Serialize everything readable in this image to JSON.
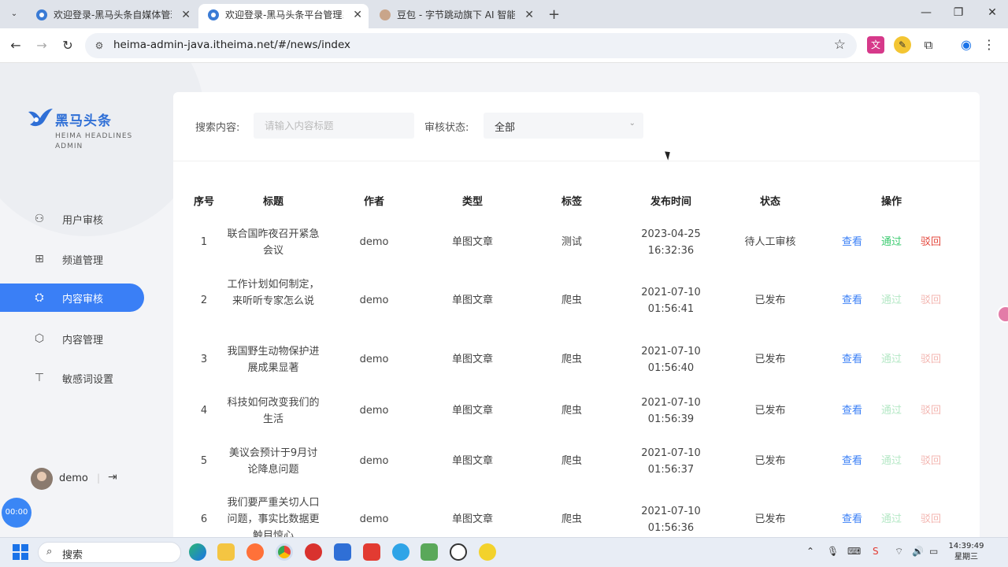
{
  "browser": {
    "tabs": [
      {
        "title": "欢迎登录-黑马头条自媒体管理",
        "active": false
      },
      {
        "title": "欢迎登录-黑马头条平台管理系",
        "active": true
      },
      {
        "title": "豆包 - 字节跳动旗下 AI 智能助",
        "active": false
      }
    ],
    "new_tab": "+",
    "url_domain": "heima-admin-java.itheima.net",
    "url_path": "/#/news/index"
  },
  "brand": {
    "name_cn": "黑马头条",
    "name_en_line1": "HEIMA HEADLINES",
    "name_en_line2": "ADMIN",
    "primary_color": "#3a7ff6"
  },
  "sidebar": {
    "items": [
      {
        "label": "用户审核",
        "icon": "user-check-icon",
        "active": false
      },
      {
        "label": "频道管理",
        "icon": "grid-icon",
        "active": false
      },
      {
        "label": "内容审核",
        "icon": "content-audit-icon",
        "active": true
      },
      {
        "label": "内容管理",
        "icon": "cube-icon",
        "active": false
      },
      {
        "label": "敏感词设置",
        "icon": "text-box-icon",
        "active": false
      }
    ],
    "user": {
      "name": "demo",
      "separator": "|"
    },
    "timer": "00:00"
  },
  "filters": {
    "search_label": "搜索内容:",
    "search_placeholder": "请输入内容标题",
    "status_label": "审核状态:",
    "status_value": "全部"
  },
  "table": {
    "columns": [
      "序号",
      "标题",
      "作者",
      "类型",
      "标签",
      "发布时间",
      "状态",
      "操作"
    ],
    "actions": {
      "view": "查看",
      "pass": "通过",
      "reject": "驳回"
    },
    "rows": [
      {
        "no": "1",
        "title": "联合国昨夜召开紧急会议",
        "author": "demo",
        "type": "单图文章",
        "tag": "测试",
        "date": "2023-04-25",
        "time": "16:32:36",
        "status": "待人工审核",
        "actions_enabled": true
      },
      {
        "no": "2",
        "title": "工作计划如何制定，来听听专家怎么说",
        "author": "demo",
        "type": "单图文章",
        "tag": "爬虫",
        "date": "2021-07-10",
        "time": "01:56:41",
        "status": "已发布",
        "actions_enabled": false
      },
      {
        "no": "3",
        "title": "我国野生动物保护进展成果显著",
        "author": "demo",
        "type": "单图文章",
        "tag": "爬虫",
        "date": "2021-07-10",
        "time": "01:56:40",
        "status": "已发布",
        "actions_enabled": false
      },
      {
        "no": "4",
        "title": "科技如何改变我们的生活",
        "author": "demo",
        "type": "单图文章",
        "tag": "爬虫",
        "date": "2021-07-10",
        "time": "01:56:39",
        "status": "已发布",
        "actions_enabled": false
      },
      {
        "no": "5",
        "title": "美议会预计于9月讨论降息问题",
        "author": "demo",
        "type": "单图文章",
        "tag": "爬虫",
        "date": "2021-07-10",
        "time": "01:56:37",
        "status": "已发布",
        "actions_enabled": false
      },
      {
        "no": "6",
        "title": "我们要严重关切人口问题，事实比数据更触目惊心",
        "author": "demo",
        "type": "单图文章",
        "tag": "爬虫",
        "date": "2021-07-10",
        "time": "01:56:36",
        "status": "已发布",
        "actions_enabled": false
      }
    ]
  },
  "taskbar": {
    "search_text": "搜索",
    "time": "14:39:49",
    "weekday": "星期三"
  }
}
